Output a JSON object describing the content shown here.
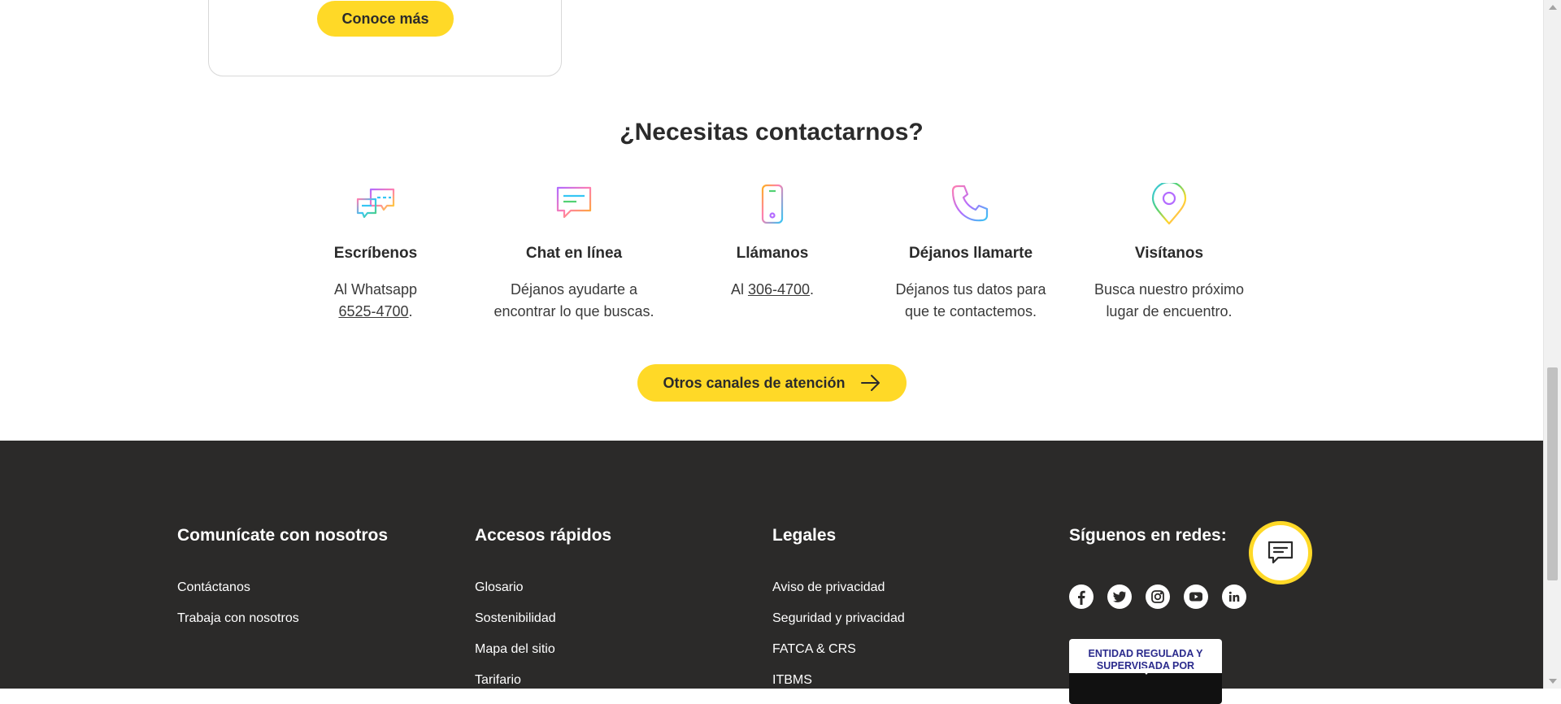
{
  "card": {
    "button_label": "Conoce más"
  },
  "contact": {
    "title": "¿Necesitas contactarnos?",
    "channels": [
      {
        "icon": "chat-bubbles-icon",
        "title": "Escríbenos",
        "text_before": "Al Whatsapp",
        "link": "6525-4700",
        "text_after": "."
      },
      {
        "icon": "chat-message-icon",
        "title": "Chat en línea",
        "text": "Déjanos ayudarte a encontrar lo que buscas."
      },
      {
        "icon": "mobile-phone-icon",
        "title": "Llámanos",
        "text_before": "Al",
        "link": "306-4700",
        "text_after": "."
      },
      {
        "icon": "phone-handset-icon",
        "title": "Déjanos llamarte",
        "text": "Déjanos tus datos para que te contactemos."
      },
      {
        "icon": "location-pin-icon",
        "title": "Visítanos",
        "text": "Busca nuestro próximo lugar de encuentro."
      }
    ],
    "other_channels_button": "Otros canales de atención"
  },
  "footer": {
    "col1": {
      "title": "Comunícate con nosotros",
      "links": [
        "Contáctanos",
        "Trabaja con nosotros"
      ]
    },
    "col2": {
      "title": "Accesos rápidos",
      "links": [
        "Glosario",
        "Sostenibilidad",
        "Mapa del sitio",
        "Tarifario"
      ]
    },
    "col3": {
      "title": "Legales",
      "links": [
        "Aviso de privacidad",
        "Seguridad y privacidad",
        "FATCA & CRS",
        "ITBMS"
      ]
    },
    "col4": {
      "title": "Síguenos en redes:"
    },
    "socials": [
      "facebook-icon",
      "twitter-icon",
      "instagram-icon",
      "youtube-icon",
      "linkedin-icon"
    ],
    "badge_text": "ENTIDAD REGULADA Y SUPERVISADA POR"
  },
  "colors": {
    "accent": "#ffd927",
    "footer_bg": "#2b2a29",
    "text": "#2b2b2b"
  }
}
